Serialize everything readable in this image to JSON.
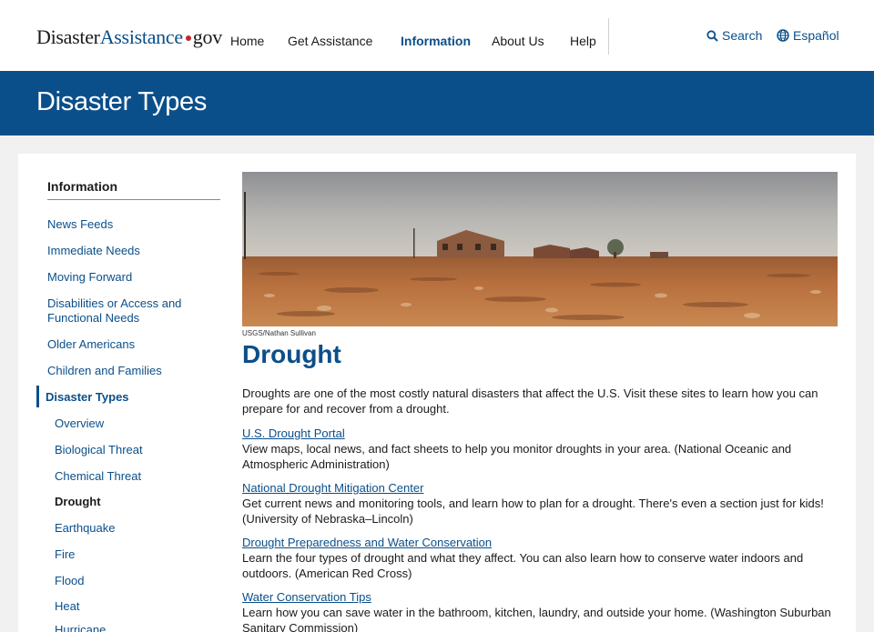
{
  "header": {
    "logo": {
      "part1": "Disaster",
      "part2": "Assistance",
      "part3": "gov"
    },
    "nav": [
      {
        "label": "Home",
        "active": false
      },
      {
        "label": "Get Assistance",
        "active": false
      },
      {
        "label": "Information",
        "active": true
      },
      {
        "label": "About Us",
        "active": false
      },
      {
        "label": "Help",
        "active": false
      }
    ],
    "search_label": "Search",
    "language_label": "Español"
  },
  "banner": {
    "title": "Disaster Types"
  },
  "sidebar": {
    "heading": "Information",
    "items": [
      {
        "label": "News Feeds"
      },
      {
        "label": "Immediate Needs"
      },
      {
        "label": "Moving Forward"
      },
      {
        "label": "Disabilities or Access and Functional Needs"
      },
      {
        "label": "Older Americans"
      },
      {
        "label": "Children and Families"
      },
      {
        "label": "Disaster Types",
        "current": true
      }
    ],
    "subitems": [
      {
        "label": "Overview"
      },
      {
        "label": "Biological Threat"
      },
      {
        "label": "Chemical Threat"
      },
      {
        "label": "Drought",
        "current": true
      },
      {
        "label": "Earthquake"
      },
      {
        "label": "Fire"
      },
      {
        "label": "Flood"
      },
      {
        "label": "Heat"
      },
      {
        "label": "Hurricane"
      }
    ]
  },
  "main": {
    "image_credit": "USGS/Nathan Sullivan",
    "title": "Drought",
    "intro": "Droughts are one of the most costly natural disasters that affect the U.S. Visit these sites to learn how you can prepare for and recover from a drought.",
    "resources": [
      {
        "title": "U.S. Drought Portal",
        "description": "View maps, local news, and fact sheets to help you monitor droughts in your area. (National Oceanic and Atmospheric Administration)"
      },
      {
        "title": "National Drought Mitigation Center",
        "description": "Get current news and monitoring tools, and learn how to plan for a drought. There's even a section just for kids! (University of Nebraska–Lincoln)"
      },
      {
        "title": "Drought Preparedness and Water Conservation",
        "description": "Learn the four types of drought and what they affect. You can also learn how to conserve water indoors and outdoors. (American Red Cross)"
      },
      {
        "title": "Water Conservation Tips",
        "description": "Learn how you can save water in the bathroom, kitchen, laundry, and outside your home. (Washington Suburban Sanitary Commission)"
      }
    ]
  },
  "colors": {
    "primary": "#0b4f8a",
    "logo_dot": "#c1272d",
    "page_bg": "#f1f1f1"
  }
}
